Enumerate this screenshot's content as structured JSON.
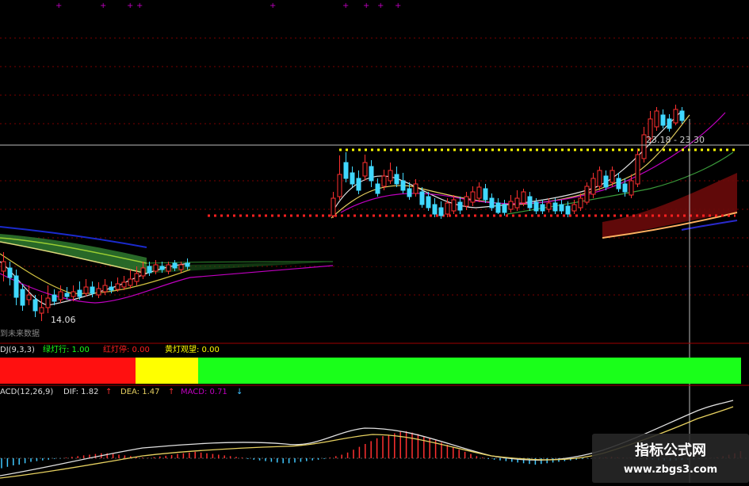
{
  "price_chart": {
    "low_label": "14.06",
    "crosshair_label": "23.18 - 23.30",
    "bottom_caption": "到未来数据",
    "candles": [
      [
        2,
        330,
        342,
        318,
        355,
        1
      ],
      [
        10,
        338,
        350,
        330,
        360,
        0
      ],
      [
        18,
        348,
        375,
        340,
        385,
        0
      ],
      [
        26,
        365,
        385,
        358,
        392,
        0
      ],
      [
        34,
        372,
        378,
        360,
        385,
        1
      ],
      [
        42,
        378,
        392,
        372,
        400,
        0
      ],
      [
        50,
        388,
        395,
        372,
        405,
        1
      ],
      [
        58,
        376,
        388,
        360,
        395,
        1
      ],
      [
        66,
        372,
        380,
        365,
        385,
        0
      ],
      [
        74,
        368,
        378,
        360,
        382,
        1
      ],
      [
        82,
        370,
        374,
        362,
        378,
        0
      ],
      [
        90,
        368,
        374,
        360,
        380,
        1
      ],
      [
        98,
        366,
        374,
        355,
        378,
        0
      ],
      [
        106,
        362,
        370,
        352,
        374,
        1
      ],
      [
        114,
        362,
        370,
        355,
        375,
        0
      ],
      [
        122,
        364,
        372,
        356,
        376,
        1
      ],
      [
        130,
        360,
        368,
        352,
        372,
        1
      ],
      [
        138,
        362,
        366,
        355,
        370,
        0
      ],
      [
        146,
        358,
        365,
        350,
        368,
        1
      ],
      [
        154,
        356,
        362,
        348,
        366,
        1
      ],
      [
        162,
        352,
        360,
        340,
        364,
        1
      ],
      [
        170,
        345,
        355,
        336,
        360,
        1
      ],
      [
        178,
        338,
        348,
        330,
        352,
        1
      ],
      [
        186,
        336,
        344,
        330,
        348,
        0
      ],
      [
        194,
        334,
        342,
        328,
        346,
        1
      ],
      [
        202,
        336,
        340,
        330,
        344,
        0
      ],
      [
        210,
        334,
        342,
        330,
        346,
        1
      ],
      [
        218,
        332,
        338,
        328,
        342,
        0
      ],
      [
        226,
        334,
        340,
        330,
        344,
        1
      ],
      [
        234,
        332,
        336,
        326,
        340,
        0
      ],
      [
        418,
        250,
        272,
        242,
        275,
        1
      ],
      [
        426,
        220,
        248,
        196,
        252,
        1
      ],
      [
        434,
        205,
        225,
        192,
        230,
        0
      ],
      [
        442,
        218,
        232,
        210,
        236,
        0
      ],
      [
        450,
        225,
        240,
        215,
        245,
        0
      ],
      [
        458,
        205,
        222,
        195,
        228,
        1
      ],
      [
        466,
        210,
        228,
        202,
        236,
        0
      ],
      [
        474,
        232,
        244,
        225,
        248,
        0
      ],
      [
        482,
        222,
        235,
        214,
        240,
        1
      ],
      [
        490,
        215,
        228,
        205,
        232,
        1
      ],
      [
        498,
        220,
        232,
        210,
        236,
        0
      ],
      [
        506,
        228,
        240,
        218,
        244,
        0
      ],
      [
        514,
        238,
        248,
        230,
        252,
        0
      ],
      [
        522,
        232,
        244,
        226,
        248,
        1
      ],
      [
        530,
        242,
        258,
        236,
        262,
        0
      ],
      [
        538,
        248,
        262,
        242,
        266,
        0
      ],
      [
        546,
        258,
        270,
        250,
        274,
        0
      ],
      [
        554,
        262,
        272,
        254,
        276,
        0
      ],
      [
        562,
        256,
        270,
        250,
        274,
        1
      ],
      [
        570,
        252,
        266,
        246,
        270,
        1
      ],
      [
        578,
        255,
        265,
        248,
        270,
        0
      ],
      [
        586,
        248,
        260,
        242,
        265,
        1
      ],
      [
        594,
        242,
        255,
        235,
        260,
        1
      ],
      [
        602,
        236,
        250,
        230,
        255,
        1
      ],
      [
        610,
        238,
        252,
        232,
        256,
        0
      ],
      [
        618,
        250,
        262,
        244,
        266,
        0
      ],
      [
        626,
        256,
        268,
        250,
        270,
        0
      ],
      [
        634,
        258,
        268,
        252,
        272,
        0
      ],
      [
        642,
        254,
        264,
        246,
        268,
        1
      ],
      [
        650,
        250,
        262,
        240,
        266,
        1
      ],
      [
        658,
        242,
        256,
        238,
        260,
        1
      ],
      [
        666,
        248,
        262,
        242,
        266,
        0
      ],
      [
        674,
        255,
        266,
        250,
        270,
        0
      ],
      [
        682,
        258,
        266,
        252,
        270,
        0
      ],
      [
        690,
        256,
        264,
        250,
        268,
        1
      ],
      [
        698,
        256,
        266,
        250,
        270,
        0
      ],
      [
        706,
        258,
        266,
        252,
        270,
        0
      ],
      [
        714,
        260,
        270,
        254,
        274,
        0
      ],
      [
        722,
        258,
        266,
        252,
        270,
        1
      ],
      [
        730,
        250,
        262,
        244,
        266,
        1
      ],
      [
        738,
        235,
        255,
        230,
        258,
        1
      ],
      [
        746,
        225,
        245,
        218,
        250,
        1
      ],
      [
        754,
        215,
        235,
        210,
        240,
        1
      ],
      [
        762,
        222,
        236,
        215,
        240,
        0
      ],
      [
        770,
        215,
        230,
        210,
        235,
        1
      ],
      [
        778,
        225,
        238,
        218,
        242,
        0
      ],
      [
        786,
        232,
        242,
        225,
        248,
        0
      ],
      [
        794,
        228,
        246,
        220,
        250,
        1
      ],
      [
        802,
        195,
        232,
        188,
        236,
        1
      ],
      [
        810,
        170,
        200,
        160,
        205,
        1
      ],
      [
        818,
        150,
        175,
        140,
        180,
        1
      ],
      [
        826,
        140,
        160,
        135,
        165,
        1
      ],
      [
        834,
        145,
        158,
        138,
        162,
        0
      ],
      [
        842,
        150,
        162,
        144,
        166,
        0
      ],
      [
        850,
        138,
        155,
        132,
        158,
        1
      ],
      [
        858,
        140,
        152,
        135,
        156,
        0
      ]
    ]
  },
  "indicator_light": {
    "name": "DJ(9,3,3)",
    "green_label": "绿灯行: 1.00",
    "red_label": "红灯停: 0.00",
    "yellow_label": "黄灯观望: 0.00",
    "green_color": "#1aff1a",
    "red_color": "#ff1010",
    "yellow_color": "#ffff00"
  },
  "macd": {
    "name": "ACD(12,26,9)",
    "dif_label": "DIF: 1.82",
    "dea_label": "DEA: 1.47",
    "macd_label": "MACD: 0.71",
    "dif_arrow": "↑",
    "dea_arrow": "↑",
    "macd_arrow": "↓",
    "bars": [
      -28,
      -24,
      -20,
      -18,
      -14,
      -10,
      -8,
      -6,
      -4,
      -2,
      -1,
      2,
      4,
      6,
      8,
      10,
      12,
      14,
      14,
      12,
      10,
      8,
      6,
      4,
      2,
      1,
      3,
      5,
      7,
      9,
      12,
      14,
      16,
      18,
      16,
      14,
      12,
      10,
      8,
      6,
      4,
      2,
      -2,
      -4,
      -6,
      -8,
      -10,
      -12,
      -14,
      -14,
      -12,
      -10,
      -8,
      -6,
      -4,
      -2,
      2,
      6,
      10,
      16,
      24,
      32,
      40,
      48,
      56,
      62,
      66,
      70,
      74,
      76,
      72,
      68,
      62,
      56,
      50,
      44,
      38,
      30,
      24,
      18,
      12,
      6,
      2,
      -2,
      -4,
      -6,
      -8,
      -10,
      -12,
      -14,
      -16,
      -18,
      -16,
      -14,
      -12,
      -10,
      -8,
      -6,
      -4,
      -2,
      -1,
      1,
      2,
      3,
      4,
      3,
      2,
      1,
      -1,
      -2,
      -3,
      -4,
      -5,
      -6,
      -7,
      -6,
      -5,
      -4,
      -3,
      -2,
      -1,
      1,
      3,
      6,
      10,
      14,
      20,
      26,
      32,
      38,
      44
    ]
  },
  "watermark": {
    "text1": "指标公式网",
    "text2": "www.zbgs3.com"
  }
}
